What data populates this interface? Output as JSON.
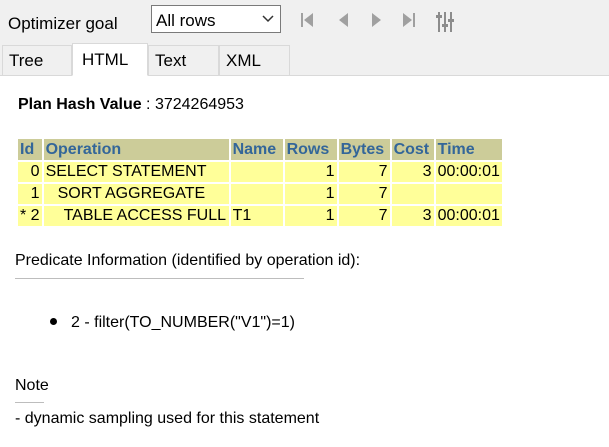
{
  "toolbar": {
    "goal_label": "Optimizer goal",
    "goal_value": "All rows",
    "buttons": [
      "first-icon",
      "previous-icon",
      "next-icon",
      "last-icon",
      "settings-sliders-icon"
    ]
  },
  "tabs": [
    {
      "label": "Tree",
      "active": false
    },
    {
      "label": "HTML",
      "active": true
    },
    {
      "label": "Text",
      "active": false
    },
    {
      "label": "XML",
      "active": false
    }
  ],
  "plan": {
    "hash_label": "Plan Hash Value",
    "hash_sep": " : ",
    "hash_value": "3724264953",
    "columns": [
      "Id",
      "Operation",
      "Name",
      "Rows",
      "Bytes",
      "Cost",
      "Time"
    ],
    "rows": [
      {
        "id": "0",
        "operation": "SELECT STATEMENT",
        "name": "",
        "rows": "1",
        "bytes": "7",
        "cost": "3",
        "time": "00:00:01"
      },
      {
        "id": "1",
        "operation": "SORT AGGREGATE",
        "name": "",
        "rows": "1",
        "bytes": "7",
        "cost": "",
        "time": ""
      },
      {
        "id": "* 2",
        "operation": "TABLE ACCESS FULL",
        "name": "T1",
        "rows": "1",
        "bytes": "7",
        "cost": "3",
        "time": "00:00:01"
      }
    ]
  },
  "predicate": {
    "title": "Predicate Information (identified by operation id):",
    "items": [
      "2 - filter(TO_NUMBER(\"V1\")=1)"
    ]
  },
  "note": {
    "title": "Note",
    "text": "- dynamic sampling used for this statement"
  }
}
